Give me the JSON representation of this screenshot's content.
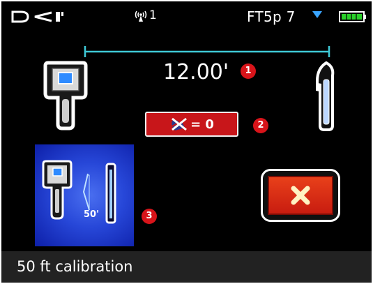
{
  "status_bar": {
    "brand": "DCI",
    "signal_icon": "antenna-icon",
    "channel": "1",
    "frequency": "FT5p 7",
    "frequency_arrow_icon": "triangle-down-icon",
    "battery_icon": "battery-icon",
    "battery_level": 1.0,
    "battery_color": "#2bd12b"
  },
  "calibration": {
    "distance": "12.00'",
    "receiver_icon": "receiver-icon",
    "transmitter_icon": "transmitter-icon",
    "offset_button": {
      "icon": "transmitter-off-icon",
      "label": "= 0"
    },
    "panel": {
      "icon": "calibration-icon",
      "distance_label": "50'"
    },
    "cancel_button": {
      "icon": "close-icon"
    },
    "badges": [
      "1",
      "2",
      "3"
    ]
  },
  "footer": {
    "title": "50 ft calibration"
  },
  "colors": {
    "accent_cyan": "#3ec9d6",
    "badge_red": "#d8141a",
    "button_red": "#c8161a",
    "panel_blue": "#2747d8"
  }
}
